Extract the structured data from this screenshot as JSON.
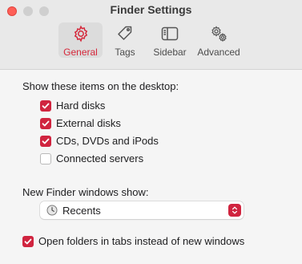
{
  "window": {
    "title": "Finder Settings"
  },
  "tabs": [
    {
      "label": "General",
      "icon": "gear-icon",
      "active": true
    },
    {
      "label": "Tags",
      "icon": "tag-icon",
      "active": false
    },
    {
      "label": "Sidebar",
      "icon": "sidebar-icon",
      "active": false
    },
    {
      "label": "Advanced",
      "icon": "gears-icon",
      "active": false
    }
  ],
  "desktop": {
    "heading": "Show these items on the desktop:",
    "items": [
      {
        "label": "Hard disks",
        "checked": true
      },
      {
        "label": "External disks",
        "checked": true
      },
      {
        "label": "CDs, DVDs and iPods",
        "checked": true
      },
      {
        "label": "Connected servers",
        "checked": false
      }
    ]
  },
  "new_window": {
    "heading": "New Finder windows show:",
    "selected": "Recents",
    "icon": "clock-icon"
  },
  "tabs_option": {
    "label": "Open folders in tabs instead of new windows",
    "checked": true
  },
  "colors": {
    "accent": "#d0243f",
    "active_tab_bg": "#dcdcdc"
  }
}
